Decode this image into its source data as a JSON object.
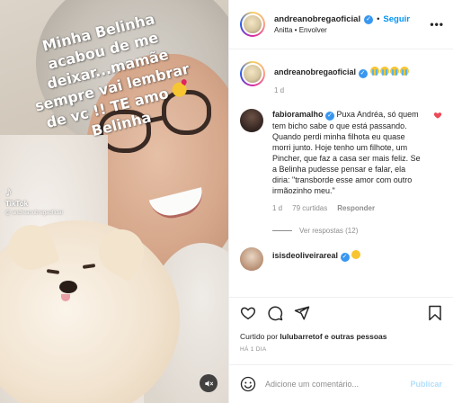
{
  "media": {
    "caption_lines": [
      "Minha Belinha",
      "acabou de me",
      "deixar...mamãe",
      "sempre vai lembrar",
      "de vc !! TE amo",
      "Belinha"
    ],
    "caption_emoji": "kissing-heart-emoji",
    "tiktok": {
      "logo": "♪",
      "name": "TikTok",
      "handle": "@ andreanobregaoficial"
    },
    "mute_icon": "speaker-muted-icon"
  },
  "header": {
    "username": "andreanobregaoficial",
    "verified_glyph": "✓",
    "separator": "•",
    "follow_label": "Seguir",
    "audio_info": "Anitta • Envolver",
    "more_glyph": "•••"
  },
  "caption_post": {
    "username": "andreanobregaoficial",
    "emoji_icons": [
      "loudly-crying-emoji",
      "loudly-crying-emoji",
      "loudly-crying-emoji",
      "loudly-crying-emoji"
    ],
    "time": "1 d"
  },
  "comment": {
    "username": "fabioramalho",
    "text": " Puxa Andréa, só quem tem bicho sabe o que está passando. Quando perdi minha filhota eu quase morri junto. Hoje tenho um filhote, um Pincher, que faz a casa ser mais feliz. Se a Belinha pudesse pensar e falar, ela diria: \"transborde esse amor com outro irmãozinho meu.\"",
    "time": "1 d",
    "likes": "79 curtidas",
    "reply_label": "Responder",
    "liked": true,
    "view_replies": "Ver respostas (12)"
  },
  "next_comment": {
    "username": "isisdeoliveirareal"
  },
  "actions": {
    "icons": [
      "heart-icon",
      "comment-icon",
      "share-icon",
      "bookmark-icon"
    ],
    "liked_by_prefix": "Curtido por ",
    "liked_by_user": "lulubarretof",
    "liked_by_suffix": " e outras pessoas",
    "posted_ago": "HÁ 1 DIA"
  },
  "add_comment": {
    "placeholder": "Adicione um comentário...",
    "publish_label": "Publicar",
    "emoji_icon": "smiley-icon"
  },
  "colors": {
    "accent": "#0095f6",
    "verified": "#3897f0",
    "like_red": "#ed4956",
    "muted_text": "#8e8e8e",
    "publish_disabled": "#b2dffc"
  }
}
